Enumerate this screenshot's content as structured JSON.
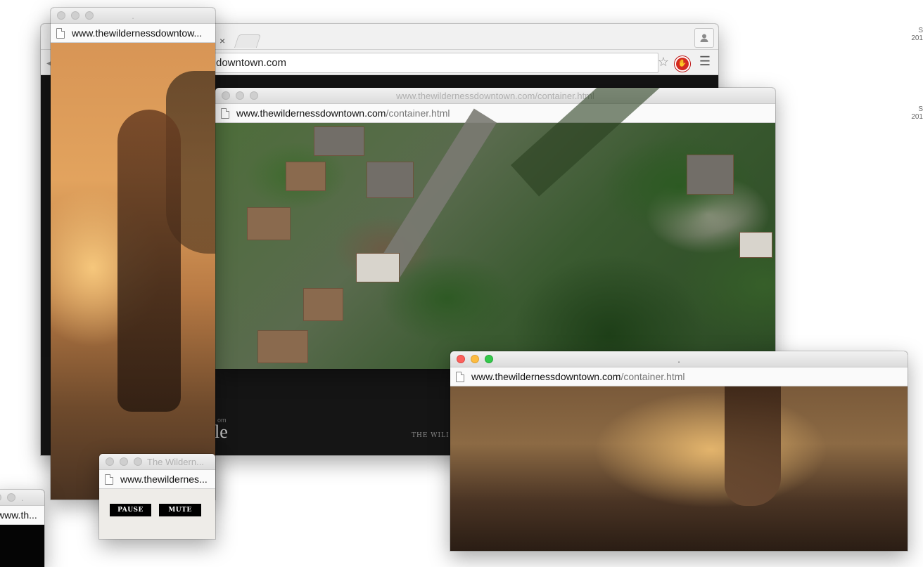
{
  "chrome_window": {
    "address_text": "downtown.com",
    "tab_close": "×",
    "profile_icon": "person-icon",
    "site_from_text": "om",
    "site_title_fragment": "le",
    "site_footer_fragment": "THE WILI"
  },
  "aerial_window": {
    "title": "www.thewildernessdowntown.com/container.html",
    "url_host": "www.thewildernessdowntown.com",
    "url_path": "/container.html"
  },
  "left_tall_window": {
    "title": ".",
    "url": "www.thewildernessdowntow..."
  },
  "control_window": {
    "title": "The Wildern...",
    "url": "www.thewildernes...",
    "pause_label": "PAUSE",
    "mute_label": "MUTE"
  },
  "bottom_left_window": {
    "title": ".",
    "url": "www.th..."
  },
  "active_window": {
    "title": ".",
    "url_host": "www.thewildernessdowntown.com",
    "url_path": "/container.html"
  },
  "desktop_edge": {
    "label_1_a": "S",
    "label_1_b": "201",
    "label_2_a": "S",
    "label_2_b": "201"
  }
}
